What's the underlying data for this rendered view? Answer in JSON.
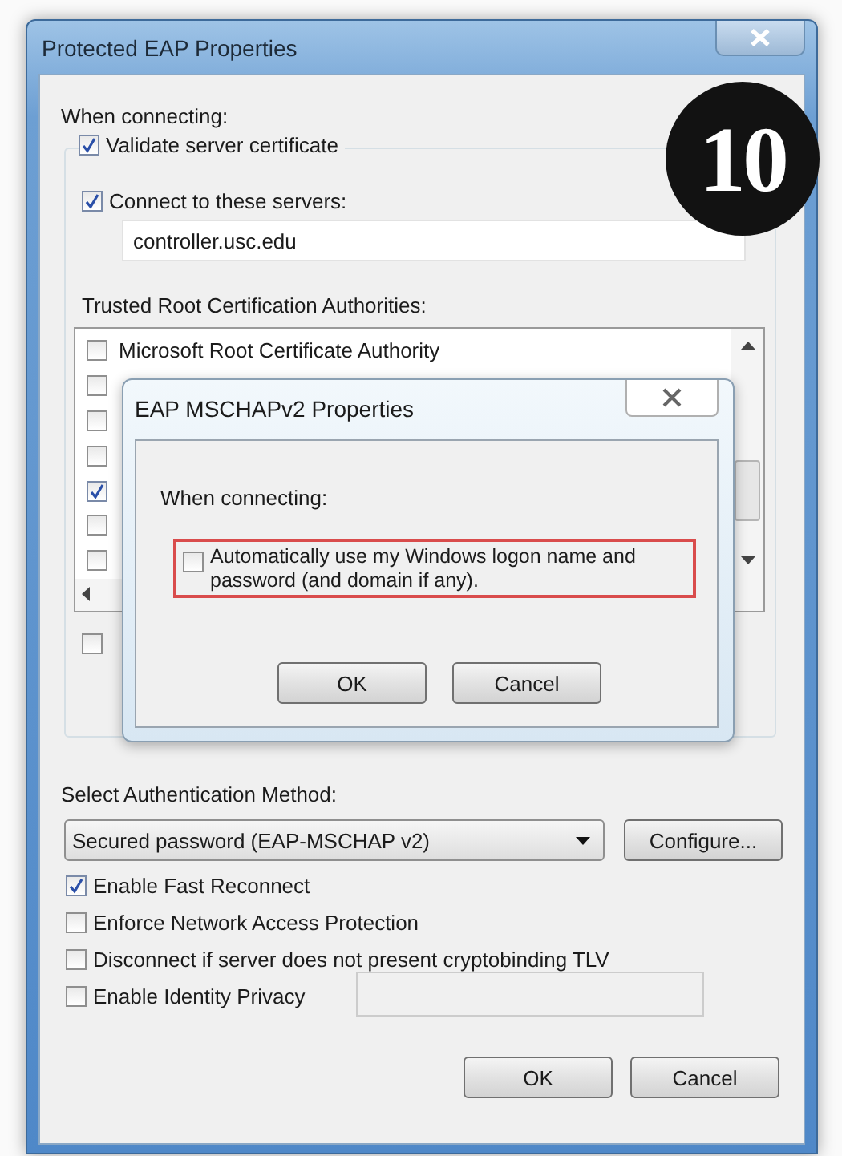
{
  "window": {
    "title": "Protected EAP Properties"
  },
  "step_badge": "10",
  "when_connecting": "When connecting:",
  "validate": {
    "label": "Validate server certificate",
    "checked": true
  },
  "connect": {
    "label": "Connect to these servers:",
    "checked": true,
    "value": "controller.usc.edu"
  },
  "trusted_label": "Trusted Root Certification Authorities:",
  "authorities": [
    {
      "label": "Microsoft Root Certificate Authority",
      "checked": false
    },
    {
      "checked": false
    },
    {
      "checked": false
    },
    {
      "checked": false
    },
    {
      "checked": true
    },
    {
      "checked": false
    },
    {
      "checked": false
    }
  ],
  "hidden_option": {
    "checked": false
  },
  "dialog": {
    "title": "EAP MSCHAPv2 Properties",
    "prompt": "When connecting:",
    "auto_logon": {
      "label": "Automatically use my Windows logon name and password (and domain if any).",
      "checked": false,
      "highlighted": true
    },
    "buttons": [
      "OK",
      "Cancel"
    ]
  },
  "auth_label": "Select Authentication Method:",
  "method": {
    "value": "Secured password (EAP-MSCHAP v2)"
  },
  "configure": "Configure...",
  "options": [
    {
      "label": "Enable Fast Reconnect",
      "checked": true
    },
    {
      "label": "Enforce Network Access Protection",
      "checked": false
    },
    {
      "label": "Disconnect if server does not present cryptobinding TLV",
      "checked": false
    },
    {
      "label": "Enable Identity Privacy",
      "checked": false
    }
  ],
  "buttons": [
    "OK",
    "Cancel"
  ]
}
